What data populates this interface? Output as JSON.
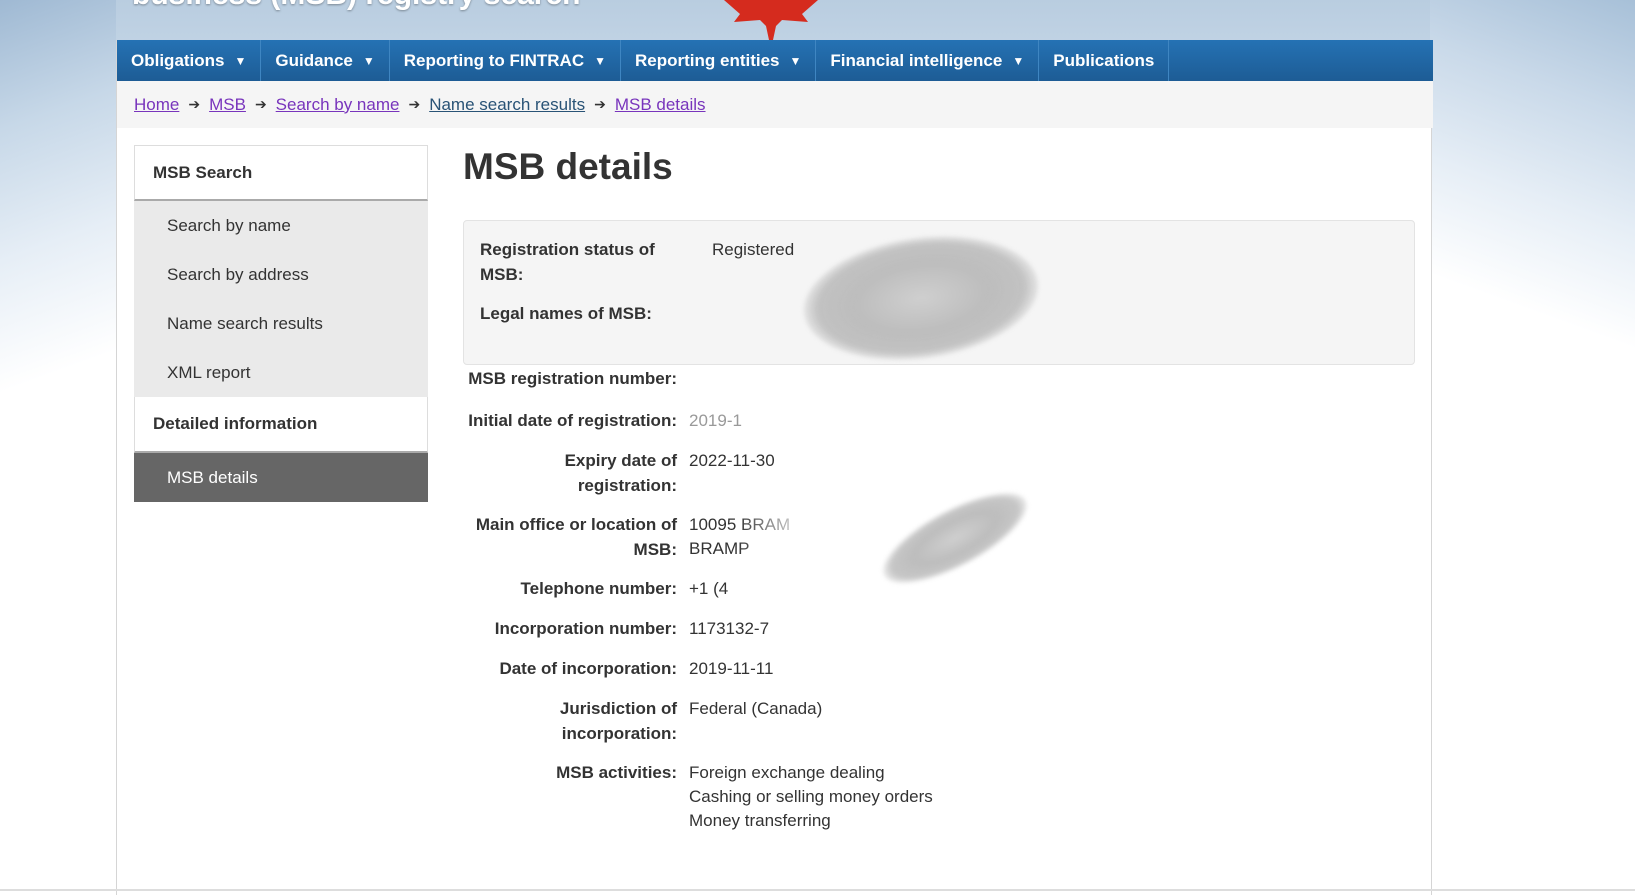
{
  "banner": {
    "title": "business (MSB) registry search"
  },
  "menu": [
    {
      "label": "Obligations",
      "has_dropdown": true
    },
    {
      "label": "Guidance",
      "has_dropdown": true
    },
    {
      "label": "Reporting to FINTRAC",
      "has_dropdown": true
    },
    {
      "label": "Reporting entities",
      "has_dropdown": true
    },
    {
      "label": "Financial intelligence",
      "has_dropdown": true
    },
    {
      "label": "Publications",
      "has_dropdown": false
    }
  ],
  "breadcrumb": [
    "Home",
    "MSB",
    "Search by name",
    "Name search results",
    "MSB details"
  ],
  "sidenav": {
    "section1_title": "MSB Search",
    "section1_items": [
      "Search by name",
      "Search by address",
      "Name search results",
      "XML report"
    ],
    "section2_title": "Detailed information",
    "section2_items": [
      "MSB details"
    ]
  },
  "page": {
    "title": "MSB details",
    "summary": {
      "status_label": "Registration status of MSB:",
      "status_value": "Registered",
      "legal_names_label": "Legal names of MSB:"
    },
    "details": {
      "reg_number_label": "MSB registration number:",
      "initial_date_label": "Initial date of registration:",
      "initial_date_value": "2019-1",
      "expiry_label": "Expiry date of registration:",
      "expiry_value": "2022-11-30",
      "main_office_label": "Main office or location of MSB:",
      "main_office_line1": "10095 BRAM",
      "main_office_line2": "BRAMP",
      "telephone_label": "Telephone number:",
      "telephone_value": "+1 (4",
      "incorporation_number_label": "Incorporation number:",
      "incorporation_number_value": "1173132-7",
      "incorporation_date_label": "Date of incorporation:",
      "incorporation_date_value": "2019-11-11",
      "jurisdiction_label": "Jurisdiction of incorporation:",
      "jurisdiction_value": "Federal (Canada)",
      "activities_label": "MSB activities:",
      "activities": [
        "Foreign exchange dealing",
        "Cashing or selling money orders",
        "Money transferring"
      ]
    }
  },
  "colors": {
    "menu_bg": "#2572b4",
    "visited_link": "#7834bc",
    "active_nav": "#666666",
    "leaf": "#d52b1e"
  }
}
